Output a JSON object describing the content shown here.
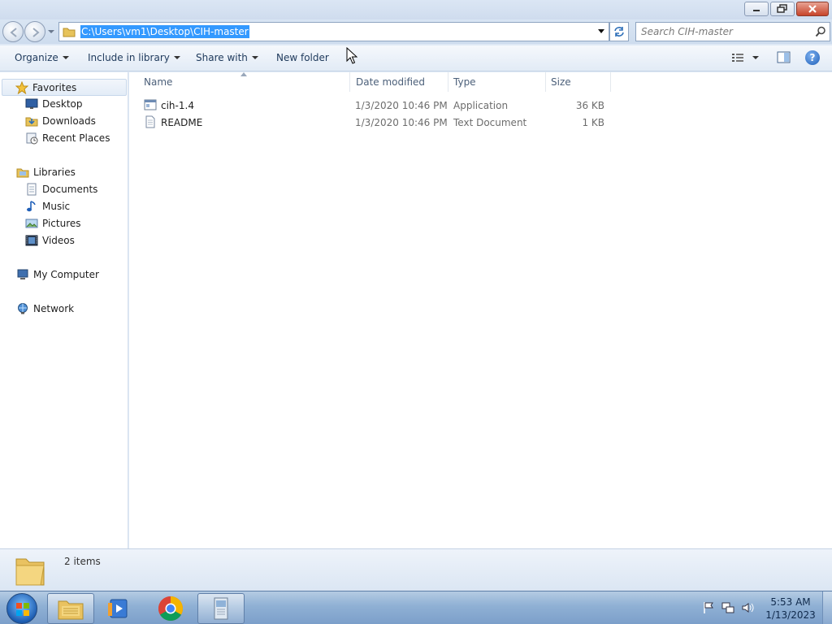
{
  "window": {
    "controls": {
      "minimize_icon": "minimize-icon",
      "maximize_icon": "restore-icon",
      "close_icon": "close-icon"
    }
  },
  "address_bar": {
    "path": "C:\\Users\\vm1\\Desktop\\CIH-master",
    "selected": true,
    "selection_color": "#3399ff"
  },
  "search": {
    "placeholder": "Search CIH-master",
    "value": ""
  },
  "toolbar": {
    "organize": "Organize",
    "include_in_library": "Include in library",
    "share_with": "Share with",
    "new_folder": "New folder"
  },
  "nav": {
    "favorites": {
      "label": "Favorites",
      "items": [
        {
          "label": "Desktop",
          "icon": "desktop-icon"
        },
        {
          "label": "Downloads",
          "icon": "downloads-icon"
        },
        {
          "label": "Recent Places",
          "icon": "recent-places-icon"
        }
      ]
    },
    "libraries": {
      "label": "Libraries",
      "items": [
        {
          "label": "Documents",
          "icon": "documents-icon"
        },
        {
          "label": "Music",
          "icon": "music-icon"
        },
        {
          "label": "Pictures",
          "icon": "pictures-icon"
        },
        {
          "label": "Videos",
          "icon": "videos-icon"
        }
      ]
    },
    "computer": {
      "label": "My Computer"
    },
    "network": {
      "label": "Network"
    }
  },
  "columns": {
    "name": "Name",
    "date": "Date modified",
    "type": "Type",
    "size": "Size"
  },
  "files": [
    {
      "name": "cih-1.4",
      "date": "1/3/2020 10:46 PM",
      "type": "Application",
      "size": "36 KB",
      "icon": "application-icon"
    },
    {
      "name": "README",
      "date": "1/3/2020 10:46 PM",
      "type": "Text Document",
      "size": "1 KB",
      "icon": "text-document-icon"
    }
  ],
  "details": {
    "count": "2 items"
  },
  "taskbar": {
    "time": "5:53 AM",
    "date": "1/13/2023",
    "pinned": [
      "explorer-icon",
      "media-player-icon",
      "chrome-icon",
      "app-window-icon"
    ]
  }
}
